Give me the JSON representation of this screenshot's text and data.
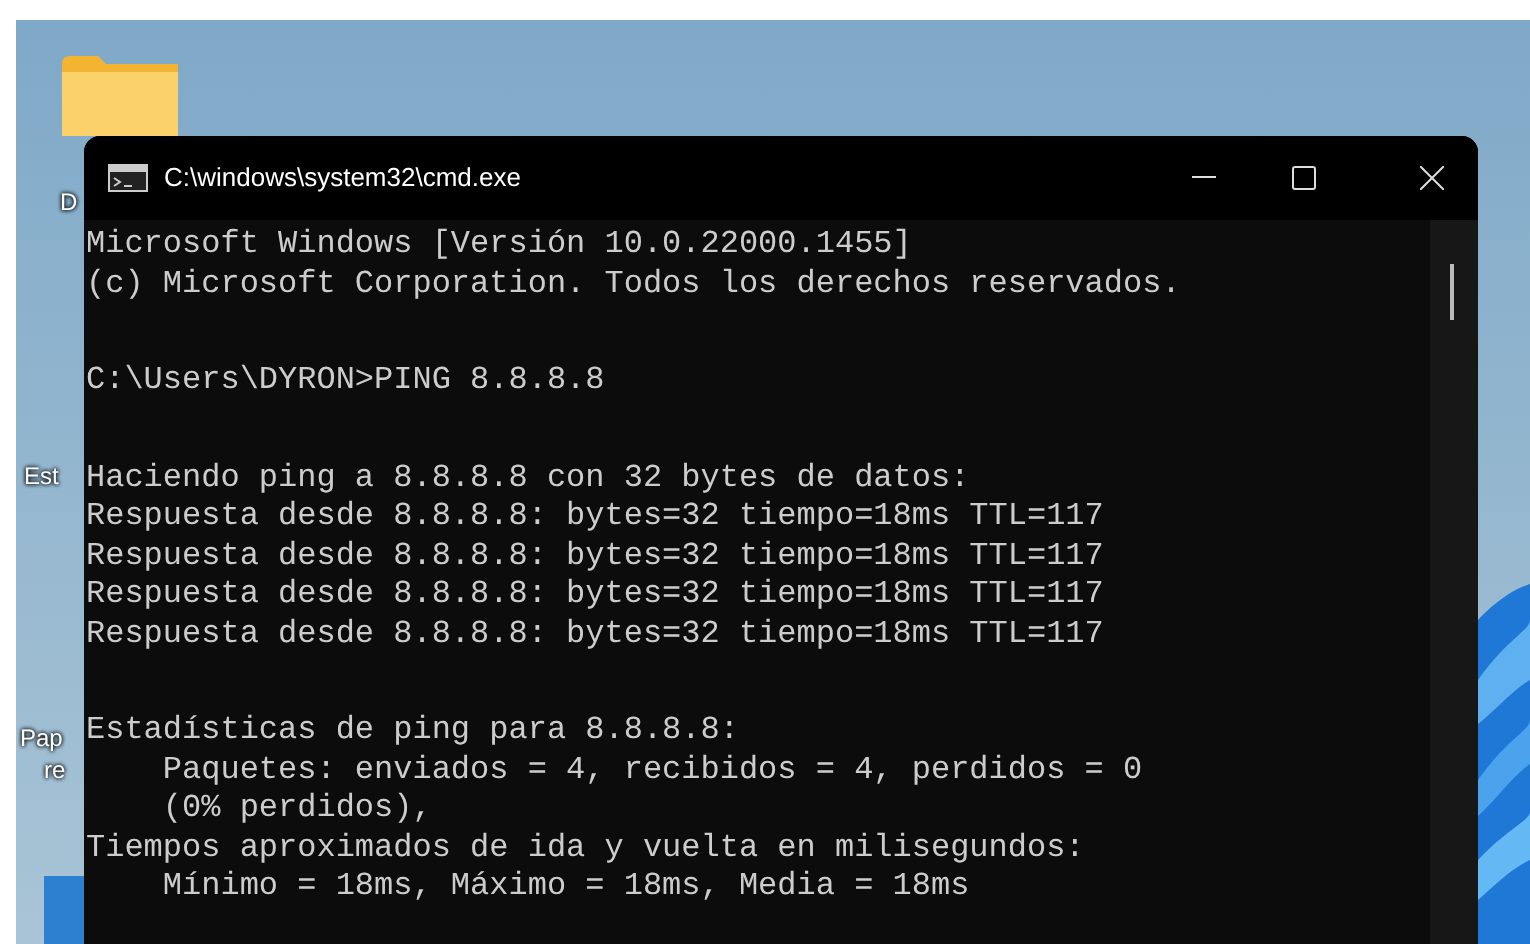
{
  "desktop_icons": [
    {
      "kind": "folder",
      "label": "D"
    },
    {
      "kind": "text",
      "label": "Est"
    },
    {
      "kind": "text",
      "label": "Pap"
    },
    {
      "kind": "text",
      "label": "re"
    },
    {
      "kind": "app"
    }
  ],
  "window": {
    "title": "C:\\windows\\system32\\cmd.exe"
  },
  "console_blocks": [
    [
      "Microsoft Windows [Versión 10.0.22000.1455]",
      "(c) Microsoft Corporation. Todos los derechos reservados."
    ],
    [
      "C:\\Users\\DYRON>PING 8.8.8.8"
    ],
    [
      "Haciendo ping a 8.8.8.8 con 32 bytes de datos:",
      "Respuesta desde 8.8.8.8: bytes=32 tiempo=18ms TTL=117",
      "Respuesta desde 8.8.8.8: bytes=32 tiempo=18ms TTL=117",
      "Respuesta desde 8.8.8.8: bytes=32 tiempo=18ms TTL=117",
      "Respuesta desde 8.8.8.8: bytes=32 tiempo=18ms TTL=117"
    ],
    [
      "Estadísticas de ping para 8.8.8.8:",
      "    Paquetes: enviados = 4, recibidos = 4, perdidos = 0",
      "    (0% perdidos),",
      "Tiempos aproximados de ida y vuelta en milisegundos:",
      "    Mínimo = 18ms, Máximo = 18ms, Media = 18ms"
    ]
  ]
}
